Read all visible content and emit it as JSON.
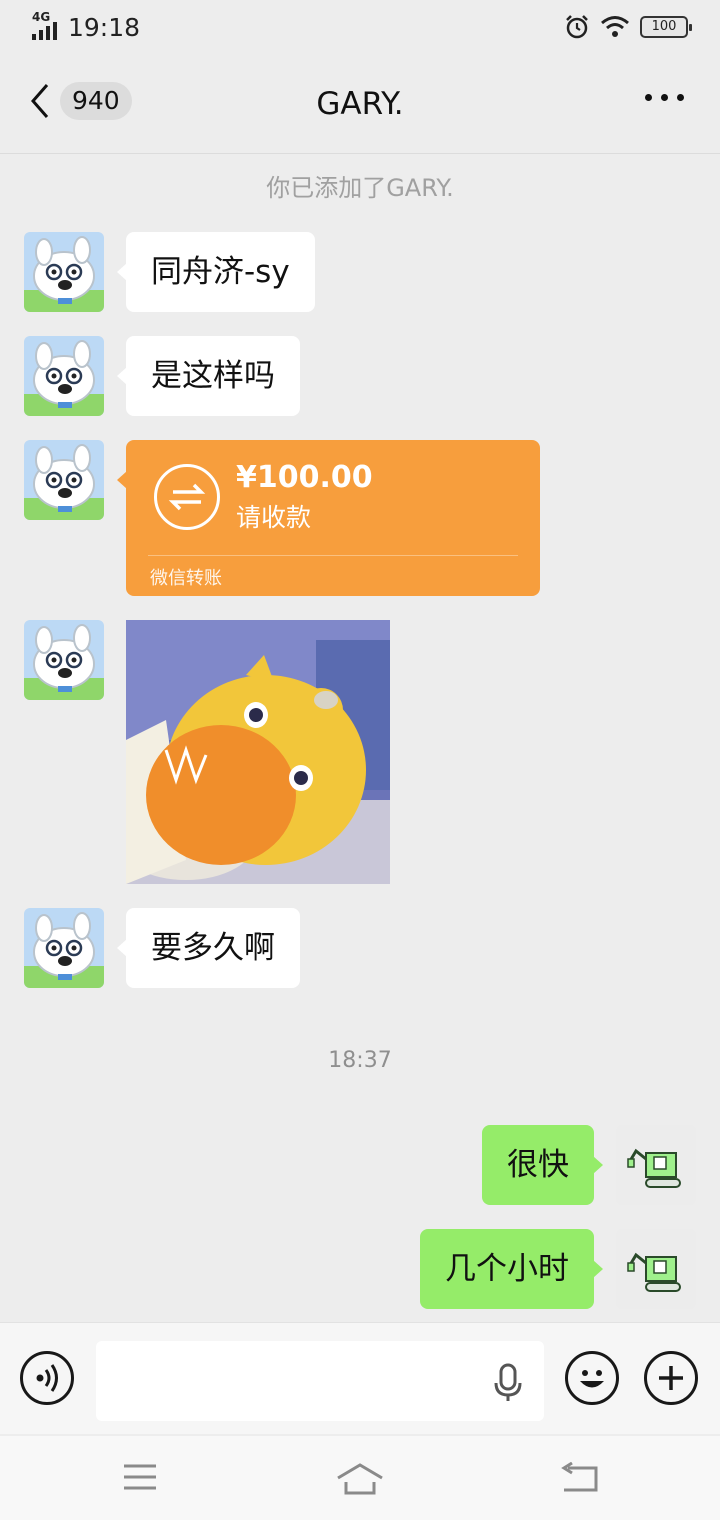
{
  "status_bar": {
    "network": "4G",
    "time": "19:18",
    "battery": "100"
  },
  "nav": {
    "unread_count": "940",
    "title": "GARY."
  },
  "chat": {
    "system_notice": "你已添加了GARY.",
    "messages_in": [
      "同舟济-sy",
      "是这样吗",
      "要多久啊"
    ],
    "transfer": {
      "amount": "¥100.00",
      "status": "请收款",
      "footer": "微信转账"
    },
    "timestamp": "18:37",
    "messages_out": [
      "很快",
      "几个小时"
    ]
  },
  "input": {
    "placeholder": ""
  },
  "colors": {
    "bubble_out": "#95ec69",
    "transfer": "#f79e3d",
    "background": "#ededed"
  }
}
